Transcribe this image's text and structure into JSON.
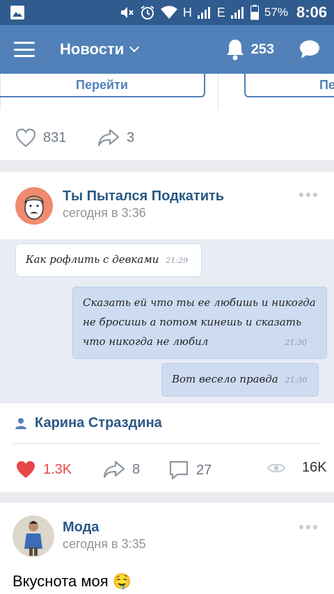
{
  "status_bar": {
    "network_h": "H",
    "network_e": "E",
    "battery": "57%",
    "time": "8:06",
    "icons": [
      "image-icon",
      "mute-icon",
      "alarm-icon",
      "wifi-icon",
      "signal-icon",
      "battery-icon"
    ]
  },
  "app_bar": {
    "title": "Новости",
    "notifications_count": "253"
  },
  "prev_post": {
    "button_label": "Перейти",
    "button_label_partial": "Пе",
    "likes": "831",
    "shares": "3"
  },
  "post": {
    "author": "Ты Пытался Подкатить",
    "time": "сегодня в 3:36",
    "chat": {
      "messages": [
        {
          "dir": "in",
          "text": "Как рофлить с девками",
          "time": "21:29"
        },
        {
          "dir": "out",
          "lines": [
            "Сказать ей что ты ее любишь и никогда",
            "не бросишь а потом кинешь и сказать",
            "что никогда не любил"
          ],
          "time": "21:30"
        },
        {
          "dir": "out",
          "text": "Вот весело правда",
          "time": "21:30"
        }
      ]
    },
    "signer": "Карина Страздина",
    "likes": "1.3K",
    "shares": "8",
    "comments": "27",
    "views": "16K",
    "liked_color": "#e64646"
  },
  "next_post": {
    "author": "Мода",
    "time": "сегодня в 3:35",
    "text": "Вкуснота моя 🤤"
  }
}
